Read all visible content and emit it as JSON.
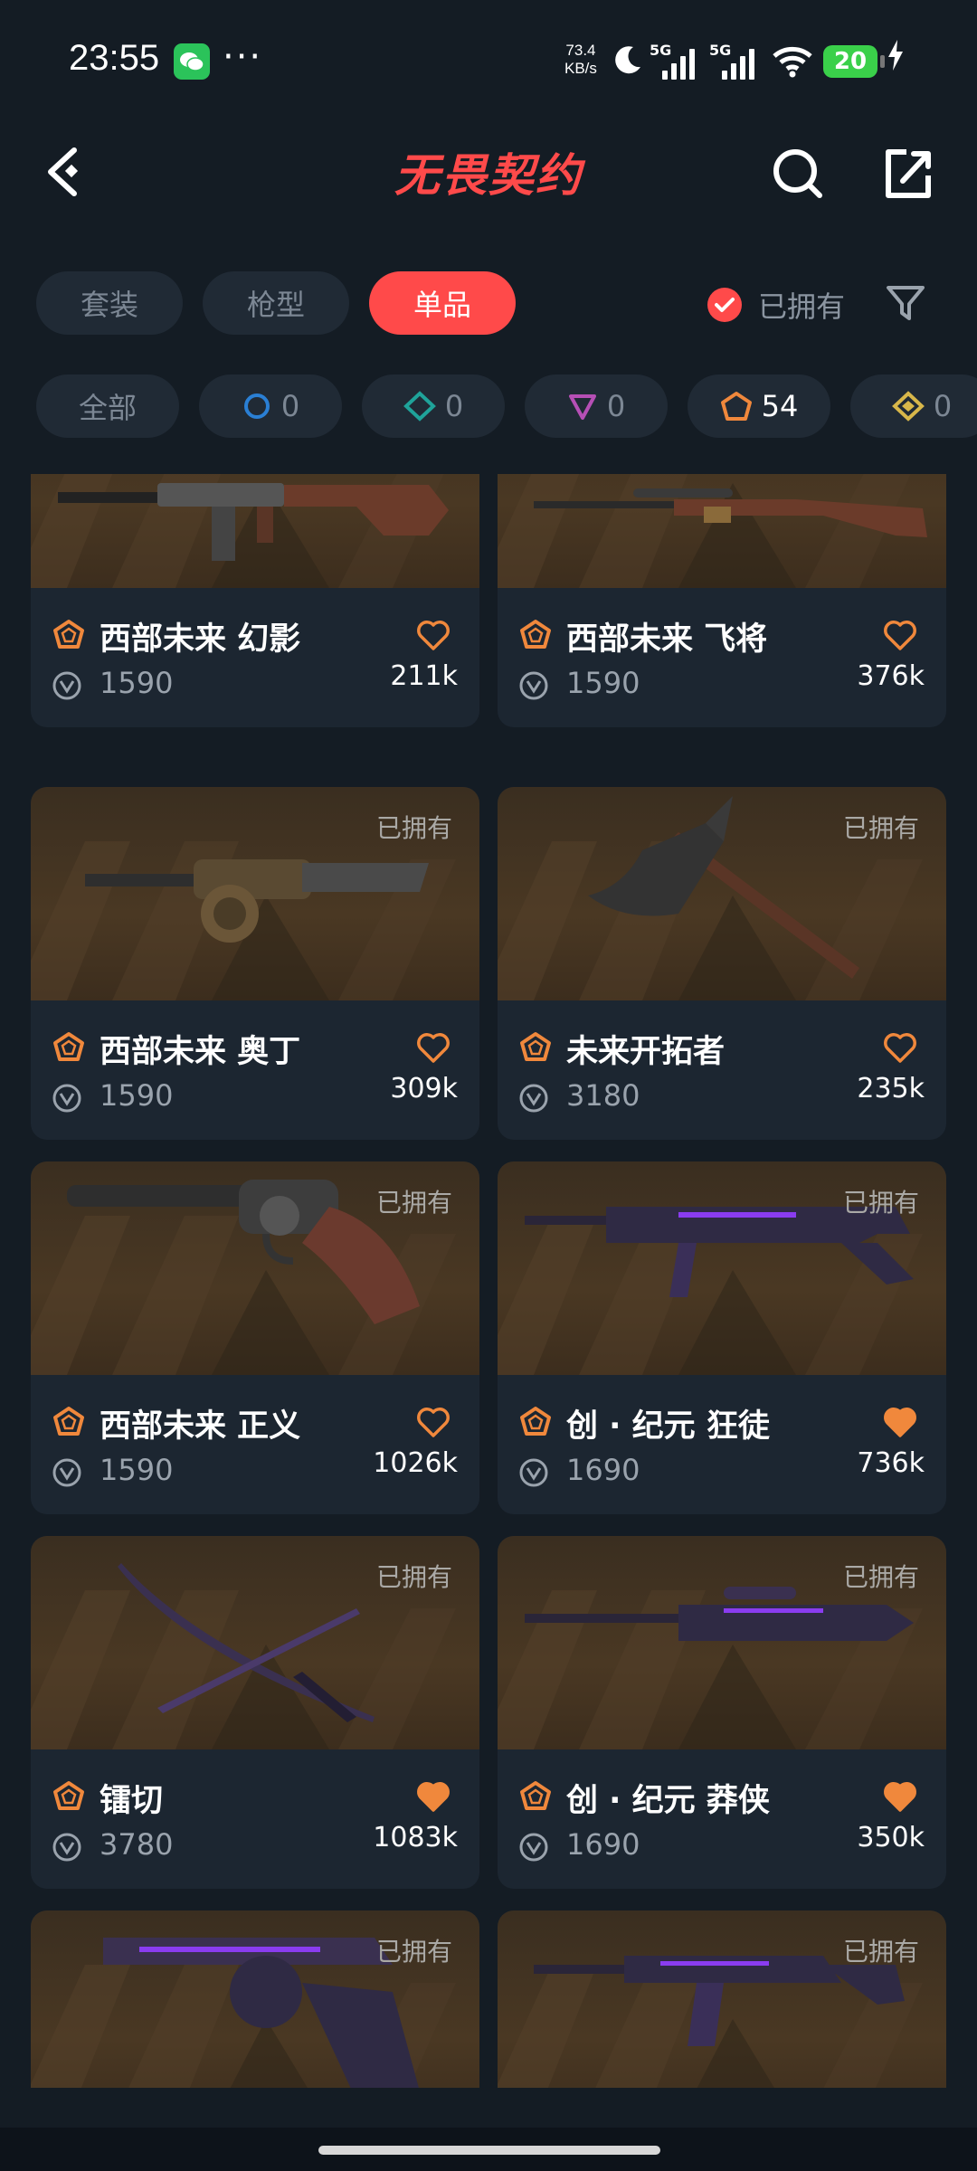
{
  "status": {
    "time": "23:55",
    "speed_top": "73.4",
    "speed_bottom": "KB/s",
    "net1": "5G",
    "net2": "5G",
    "battery": "20"
  },
  "header": {
    "logo": "无畏契约"
  },
  "tabs": [
    {
      "label": "套装",
      "active": false
    },
    {
      "label": "枪型",
      "active": false
    },
    {
      "label": "单品",
      "active": true
    }
  ],
  "owned_filter": {
    "label": "已拥有",
    "checked": true
  },
  "chips": [
    {
      "label": "全部",
      "icon": "all",
      "color": ""
    },
    {
      "label": "0",
      "icon": "circle",
      "color": "#2a7fd4"
    },
    {
      "label": "0",
      "icon": "diamond",
      "color": "#1fa39a"
    },
    {
      "label": "0",
      "icon": "triangle",
      "color": "#b64fb5"
    },
    {
      "label": "54",
      "icon": "pentagon",
      "color": "#f0883c",
      "active": true
    },
    {
      "label": "0",
      "icon": "diamond",
      "color": "#d8b74a"
    }
  ],
  "cards": [
    {
      "name": "西部未来 幻影",
      "price": "1590",
      "likes": "211k",
      "owned": "",
      "liked": false,
      "weapon": "rifle"
    },
    {
      "name": "西部未来 飞将",
      "price": "1590",
      "likes": "376k",
      "owned": "",
      "liked": false,
      "weapon": "sniper"
    },
    {
      "name": "西部未来 奥丁",
      "price": "1590",
      "likes": "309k",
      "owned": "已拥有",
      "liked": false,
      "weapon": "mg"
    },
    {
      "name": "未来开拓者",
      "price": "3180",
      "likes": "235k",
      "owned": "已拥有",
      "liked": false,
      "weapon": "axe"
    },
    {
      "name": "西部未来 正义",
      "price": "1590",
      "likes": "1026k",
      "owned": "已拥有",
      "liked": false,
      "weapon": "revolver"
    },
    {
      "name": "创 · 纪元 狂徒",
      "price": "1690",
      "likes": "736k",
      "owned": "已拥有",
      "liked": true,
      "weapon": "vandal"
    },
    {
      "name": "镭切",
      "price": "3780",
      "likes": "1083k",
      "owned": "已拥有",
      "liked": true,
      "weapon": "blades"
    },
    {
      "name": "创 · 纪元 莽侠",
      "price": "1690",
      "likes": "350k",
      "owned": "已拥有",
      "liked": true,
      "weapon": "outlaw"
    },
    {
      "name": "",
      "price": "",
      "likes": "",
      "owned": "已拥有",
      "liked": false,
      "weapon": "pistol"
    },
    {
      "name": "",
      "price": "",
      "likes": "",
      "owned": "已拥有",
      "liked": false,
      "weapon": "smg"
    }
  ],
  "colors": {
    "accent": "#ff4a4a",
    "tier": "#f0883c",
    "heart": "#f0883c"
  }
}
